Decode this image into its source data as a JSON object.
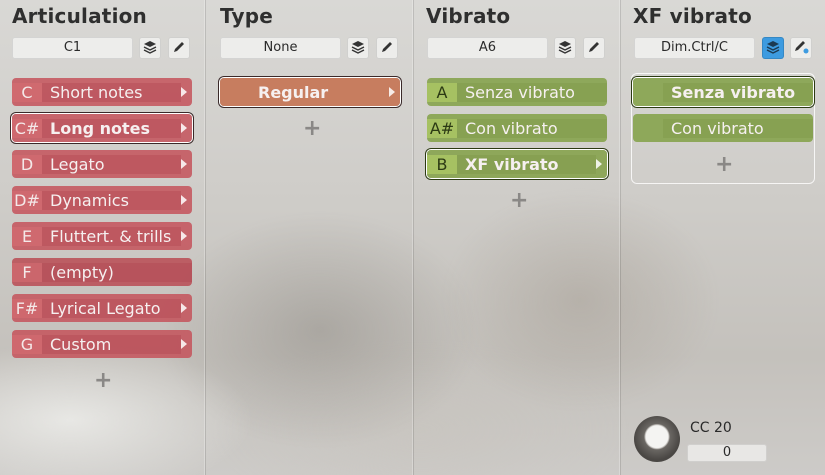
{
  "columns": [
    {
      "title": "Articulation",
      "selector_value": "C1",
      "items": [
        {
          "key": "C",
          "label": "Short notes"
        },
        {
          "key": "C#",
          "label": "Long notes"
        },
        {
          "key": "D",
          "label": "Legato"
        },
        {
          "key": "D#",
          "label": "Dynamics"
        },
        {
          "key": "E",
          "label": "Fluttert. & trills"
        },
        {
          "key": "F",
          "label": "(empty)"
        },
        {
          "key": "F#",
          "label": "Lyrical Legato"
        },
        {
          "key": "G",
          "label": "Custom"
        }
      ],
      "add_label": "+"
    },
    {
      "title": "Type",
      "selector_value": "None",
      "items": [
        {
          "key": "",
          "label": "Regular"
        }
      ],
      "add_label": "+"
    },
    {
      "title": "Vibrato",
      "selector_value": "A6",
      "items": [
        {
          "key": "A",
          "label": "Senza vibrato"
        },
        {
          "key": "A#",
          "label": "Con vibrato"
        },
        {
          "key": "B",
          "label": "XF vibrato"
        }
      ],
      "add_label": "+"
    },
    {
      "title": "XF vibrato",
      "selector_value": "Dim.Ctrl/C",
      "items": [
        {
          "key": "",
          "label": "Senza vibrato"
        },
        {
          "key": "",
          "label": "Con vibrato"
        }
      ],
      "add_label": "+"
    }
  ],
  "controller": {
    "label": "CC 20",
    "value": "0"
  },
  "icons": {
    "layers": "layers-icon",
    "edit": "pencil-icon",
    "knob": "knob"
  },
  "colors": {
    "articulation": "#c4525a",
    "type": "#c67858",
    "vibrato": "#88a450",
    "active_icon": "#3d9be0"
  }
}
